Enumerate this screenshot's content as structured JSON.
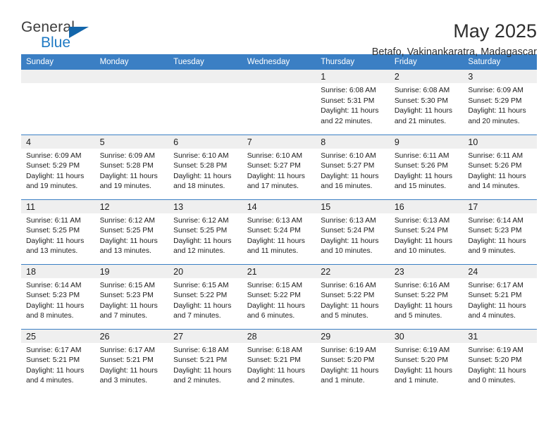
{
  "logo": {
    "word1": "General",
    "word2": "Blue",
    "triangle_color": "#1366ab",
    "blue_color": "#1f7ac4"
  },
  "header": {
    "title": "May 2025",
    "location": "Betafo, Vakinankaratra, Madagascar",
    "header_bg": "#3b7fc4",
    "daynum_bg": "#efefef"
  },
  "weekdays": [
    "Sunday",
    "Monday",
    "Tuesday",
    "Wednesday",
    "Thursday",
    "Friday",
    "Saturday"
  ],
  "weeks": [
    [
      {
        "day": "",
        "blank": true,
        "sunrise": "",
        "sunset": "",
        "daylight1": "",
        "daylight2": ""
      },
      {
        "day": "",
        "blank": true,
        "sunrise": "",
        "sunset": "",
        "daylight1": "",
        "daylight2": ""
      },
      {
        "day": "",
        "blank": true,
        "sunrise": "",
        "sunset": "",
        "daylight1": "",
        "daylight2": ""
      },
      {
        "day": "",
        "blank": true,
        "sunrise": "",
        "sunset": "",
        "daylight1": "",
        "daylight2": ""
      },
      {
        "day": "1",
        "blank": false,
        "sunrise": "Sunrise: 6:08 AM",
        "sunset": "Sunset: 5:31 PM",
        "daylight1": "Daylight: 11 hours",
        "daylight2": "and 22 minutes."
      },
      {
        "day": "2",
        "blank": false,
        "sunrise": "Sunrise: 6:08 AM",
        "sunset": "Sunset: 5:30 PM",
        "daylight1": "Daylight: 11 hours",
        "daylight2": "and 21 minutes."
      },
      {
        "day": "3",
        "blank": false,
        "sunrise": "Sunrise: 6:09 AM",
        "sunset": "Sunset: 5:29 PM",
        "daylight1": "Daylight: 11 hours",
        "daylight2": "and 20 minutes."
      }
    ],
    [
      {
        "day": "4",
        "blank": false,
        "sunrise": "Sunrise: 6:09 AM",
        "sunset": "Sunset: 5:29 PM",
        "daylight1": "Daylight: 11 hours",
        "daylight2": "and 19 minutes."
      },
      {
        "day": "5",
        "blank": false,
        "sunrise": "Sunrise: 6:09 AM",
        "sunset": "Sunset: 5:28 PM",
        "daylight1": "Daylight: 11 hours",
        "daylight2": "and 19 minutes."
      },
      {
        "day": "6",
        "blank": false,
        "sunrise": "Sunrise: 6:10 AM",
        "sunset": "Sunset: 5:28 PM",
        "daylight1": "Daylight: 11 hours",
        "daylight2": "and 18 minutes."
      },
      {
        "day": "7",
        "blank": false,
        "sunrise": "Sunrise: 6:10 AM",
        "sunset": "Sunset: 5:27 PM",
        "daylight1": "Daylight: 11 hours",
        "daylight2": "and 17 minutes."
      },
      {
        "day": "8",
        "blank": false,
        "sunrise": "Sunrise: 6:10 AM",
        "sunset": "Sunset: 5:27 PM",
        "daylight1": "Daylight: 11 hours",
        "daylight2": "and 16 minutes."
      },
      {
        "day": "9",
        "blank": false,
        "sunrise": "Sunrise: 6:11 AM",
        "sunset": "Sunset: 5:26 PM",
        "daylight1": "Daylight: 11 hours",
        "daylight2": "and 15 minutes."
      },
      {
        "day": "10",
        "blank": false,
        "sunrise": "Sunrise: 6:11 AM",
        "sunset": "Sunset: 5:26 PM",
        "daylight1": "Daylight: 11 hours",
        "daylight2": "and 14 minutes."
      }
    ],
    [
      {
        "day": "11",
        "blank": false,
        "sunrise": "Sunrise: 6:11 AM",
        "sunset": "Sunset: 5:25 PM",
        "daylight1": "Daylight: 11 hours",
        "daylight2": "and 13 minutes."
      },
      {
        "day": "12",
        "blank": false,
        "sunrise": "Sunrise: 6:12 AM",
        "sunset": "Sunset: 5:25 PM",
        "daylight1": "Daylight: 11 hours",
        "daylight2": "and 13 minutes."
      },
      {
        "day": "13",
        "blank": false,
        "sunrise": "Sunrise: 6:12 AM",
        "sunset": "Sunset: 5:25 PM",
        "daylight1": "Daylight: 11 hours",
        "daylight2": "and 12 minutes."
      },
      {
        "day": "14",
        "blank": false,
        "sunrise": "Sunrise: 6:13 AM",
        "sunset": "Sunset: 5:24 PM",
        "daylight1": "Daylight: 11 hours",
        "daylight2": "and 11 minutes."
      },
      {
        "day": "15",
        "blank": false,
        "sunrise": "Sunrise: 6:13 AM",
        "sunset": "Sunset: 5:24 PM",
        "daylight1": "Daylight: 11 hours",
        "daylight2": "and 10 minutes."
      },
      {
        "day": "16",
        "blank": false,
        "sunrise": "Sunrise: 6:13 AM",
        "sunset": "Sunset: 5:24 PM",
        "daylight1": "Daylight: 11 hours",
        "daylight2": "and 10 minutes."
      },
      {
        "day": "17",
        "blank": false,
        "sunrise": "Sunrise: 6:14 AM",
        "sunset": "Sunset: 5:23 PM",
        "daylight1": "Daylight: 11 hours",
        "daylight2": "and 9 minutes."
      }
    ],
    [
      {
        "day": "18",
        "blank": false,
        "sunrise": "Sunrise: 6:14 AM",
        "sunset": "Sunset: 5:23 PM",
        "daylight1": "Daylight: 11 hours",
        "daylight2": "and 8 minutes."
      },
      {
        "day": "19",
        "blank": false,
        "sunrise": "Sunrise: 6:15 AM",
        "sunset": "Sunset: 5:23 PM",
        "daylight1": "Daylight: 11 hours",
        "daylight2": "and 7 minutes."
      },
      {
        "day": "20",
        "blank": false,
        "sunrise": "Sunrise: 6:15 AM",
        "sunset": "Sunset: 5:22 PM",
        "daylight1": "Daylight: 11 hours",
        "daylight2": "and 7 minutes."
      },
      {
        "day": "21",
        "blank": false,
        "sunrise": "Sunrise: 6:15 AM",
        "sunset": "Sunset: 5:22 PM",
        "daylight1": "Daylight: 11 hours",
        "daylight2": "and 6 minutes."
      },
      {
        "day": "22",
        "blank": false,
        "sunrise": "Sunrise: 6:16 AM",
        "sunset": "Sunset: 5:22 PM",
        "daylight1": "Daylight: 11 hours",
        "daylight2": "and 5 minutes."
      },
      {
        "day": "23",
        "blank": false,
        "sunrise": "Sunrise: 6:16 AM",
        "sunset": "Sunset: 5:22 PM",
        "daylight1": "Daylight: 11 hours",
        "daylight2": "and 5 minutes."
      },
      {
        "day": "24",
        "blank": false,
        "sunrise": "Sunrise: 6:17 AM",
        "sunset": "Sunset: 5:21 PM",
        "daylight1": "Daylight: 11 hours",
        "daylight2": "and 4 minutes."
      }
    ],
    [
      {
        "day": "25",
        "blank": false,
        "sunrise": "Sunrise: 6:17 AM",
        "sunset": "Sunset: 5:21 PM",
        "daylight1": "Daylight: 11 hours",
        "daylight2": "and 4 minutes."
      },
      {
        "day": "26",
        "blank": false,
        "sunrise": "Sunrise: 6:17 AM",
        "sunset": "Sunset: 5:21 PM",
        "daylight1": "Daylight: 11 hours",
        "daylight2": "and 3 minutes."
      },
      {
        "day": "27",
        "blank": false,
        "sunrise": "Sunrise: 6:18 AM",
        "sunset": "Sunset: 5:21 PM",
        "daylight1": "Daylight: 11 hours",
        "daylight2": "and 2 minutes."
      },
      {
        "day": "28",
        "blank": false,
        "sunrise": "Sunrise: 6:18 AM",
        "sunset": "Sunset: 5:21 PM",
        "daylight1": "Daylight: 11 hours",
        "daylight2": "and 2 minutes."
      },
      {
        "day": "29",
        "blank": false,
        "sunrise": "Sunrise: 6:19 AM",
        "sunset": "Sunset: 5:20 PM",
        "daylight1": "Daylight: 11 hours",
        "daylight2": "and 1 minute."
      },
      {
        "day": "30",
        "blank": false,
        "sunrise": "Sunrise: 6:19 AM",
        "sunset": "Sunset: 5:20 PM",
        "daylight1": "Daylight: 11 hours",
        "daylight2": "and 1 minute."
      },
      {
        "day": "31",
        "blank": false,
        "sunrise": "Sunrise: 6:19 AM",
        "sunset": "Sunset: 5:20 PM",
        "daylight1": "Daylight: 11 hours",
        "daylight2": "and 0 minutes."
      }
    ]
  ]
}
